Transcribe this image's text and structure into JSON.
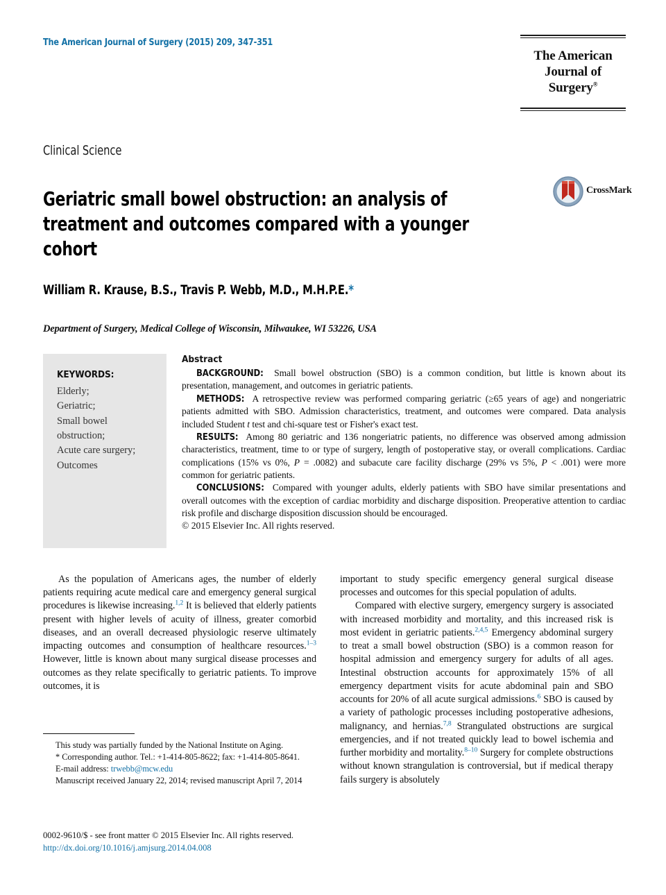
{
  "masthead": {
    "journal_reference": "The American Journal of Surgery (2015) 209, 347-351",
    "logo_line1": "The American",
    "logo_line2": "Journal of Surgery",
    "logo_trademark": "®"
  },
  "article": {
    "section_label": "Clinical Science",
    "title": "Geriatric small bowel obstruction: an analysis of treatment and outcomes compared with a younger cohort",
    "authors": "William R. Krause, B.S., Travis P. Webb, M.D., M.H.P.E.",
    "author_footnote_marker": "*",
    "affiliation": "Department of Surgery, Medical College of Wisconsin, Milwaukee, WI 53226, USA"
  },
  "crossmark": {
    "label": "CrossMark",
    "circle_color": "#8aa4bd",
    "ribbon_color": "#c0281e"
  },
  "keywords": {
    "heading": "KEYWORDS:",
    "items": [
      "Elderly;",
      "Geriatric;",
      "Small bowel",
      "obstruction;",
      "Acute care surgery;",
      "Outcomes"
    ]
  },
  "abstract": {
    "heading": "Abstract",
    "background_label": "BACKGROUND:",
    "background_text": "Small bowel obstruction (SBO) is a common condition, but little is known about its presentation, management, and outcomes in geriatric patients.",
    "methods_label": "METHODS:",
    "methods_text_1": "A retrospective review was performed comparing geriatric (≥65 years of age) and nongeriatric patients admitted with SBO. Admission characteristics, treatment, and outcomes were compared. Data analysis included Student ",
    "methods_italic_t": "t",
    "methods_text_2": " test and chi-square test or Fisher's exact test.",
    "results_label": "RESULTS:",
    "results_text_1": "Among 80 geriatric and 136 nongeriatric patients, no difference was observed among admission characteristics, treatment, time to or type of surgery, length of postoperative stay, or overall complications. Cardiac complications (15% vs 0%, ",
    "results_p1": "P",
    "results_text_2": " = .0082) and subacute care facility discharge (29% vs 5%, ",
    "results_p2": "P",
    "results_text_3": " < .001) were more common for geriatric patients.",
    "conclusions_label": "CONCLUSIONS:",
    "conclusions_text": "Compared with younger adults, elderly patients with SBO have similar presentations and overall outcomes with the exception of cardiac morbidity and discharge disposition. Preoperative attention to cardiac risk profile and discharge disposition discussion should be encouraged.",
    "copyright": "© 2015 Elsevier Inc. All rights reserved."
  },
  "body": {
    "left_paragraph_1_a": "As the population of Americans ages, the number of elderly patients requiring acute medical care and emergency general surgical procedures is likewise increasing.",
    "left_cite_1": "1,2",
    "left_paragraph_1_b": " It is believed that elderly patients present with higher levels of acuity of illness, greater comorbid diseases, and an overall decreased physiologic reserve ultimately impacting outcomes and consumption of healthcare resources.",
    "left_cite_2": "1–3",
    "left_paragraph_1_c": " However, little is known about many surgical disease processes and outcomes as they relate specifically to geriatric patients. To improve outcomes, it is",
    "right_paragraph_1": "important to study specific emergency general surgical disease processes and outcomes for this special population of adults.",
    "right_paragraph_2_a": "Compared with elective surgery, emergency surgery is associated with increased morbidity and mortality, and this increased risk is most evident in geriatric patients.",
    "right_cite_1": "2,4,5",
    "right_paragraph_2_b": " Emergency abdominal surgery to treat a small bowel obstruction (SBO) is a common reason for hospital admission and emergency surgery for adults of all ages. Intestinal obstruction accounts for approximately 15% of all emergency department visits for acute abdominal pain and SBO accounts for 20% of all acute surgical admissions.",
    "right_cite_2": "6",
    "right_paragraph_2_c": " SBO is caused by a variety of pathologic processes including postoperative adhesions, malignancy, and hernias.",
    "right_cite_3": "7,8",
    "right_paragraph_2_d": " Strangulated obstructions are surgical emergencies, and if not treated quickly lead to bowel ischemia and further morbidity and mortality.",
    "right_cite_4": "8–10",
    "right_paragraph_2_e": " Surgery for complete obstructions without known strangulation is controversial, but if medical therapy fails surgery is absolutely"
  },
  "footnotes": {
    "funding": "This study was partially funded by the National Institute on Aging.",
    "corresponding_marker": "*",
    "corresponding": " Corresponding author. Tel.: +1-414-805-8622; fax: +1-414-805-8641.",
    "email_label": "E-mail address:",
    "email": "trwebb@mcw.edu",
    "manuscript_dates": "Manuscript received January 22, 2014; revised manuscript April 7, 2014"
  },
  "footer": {
    "issn_line": "0002-9610/$ - see front matter © 2015 Elsevier Inc. All rights reserved.",
    "doi": "http://dx.doi.org/10.1016/j.amjsurg.2014.04.008"
  }
}
